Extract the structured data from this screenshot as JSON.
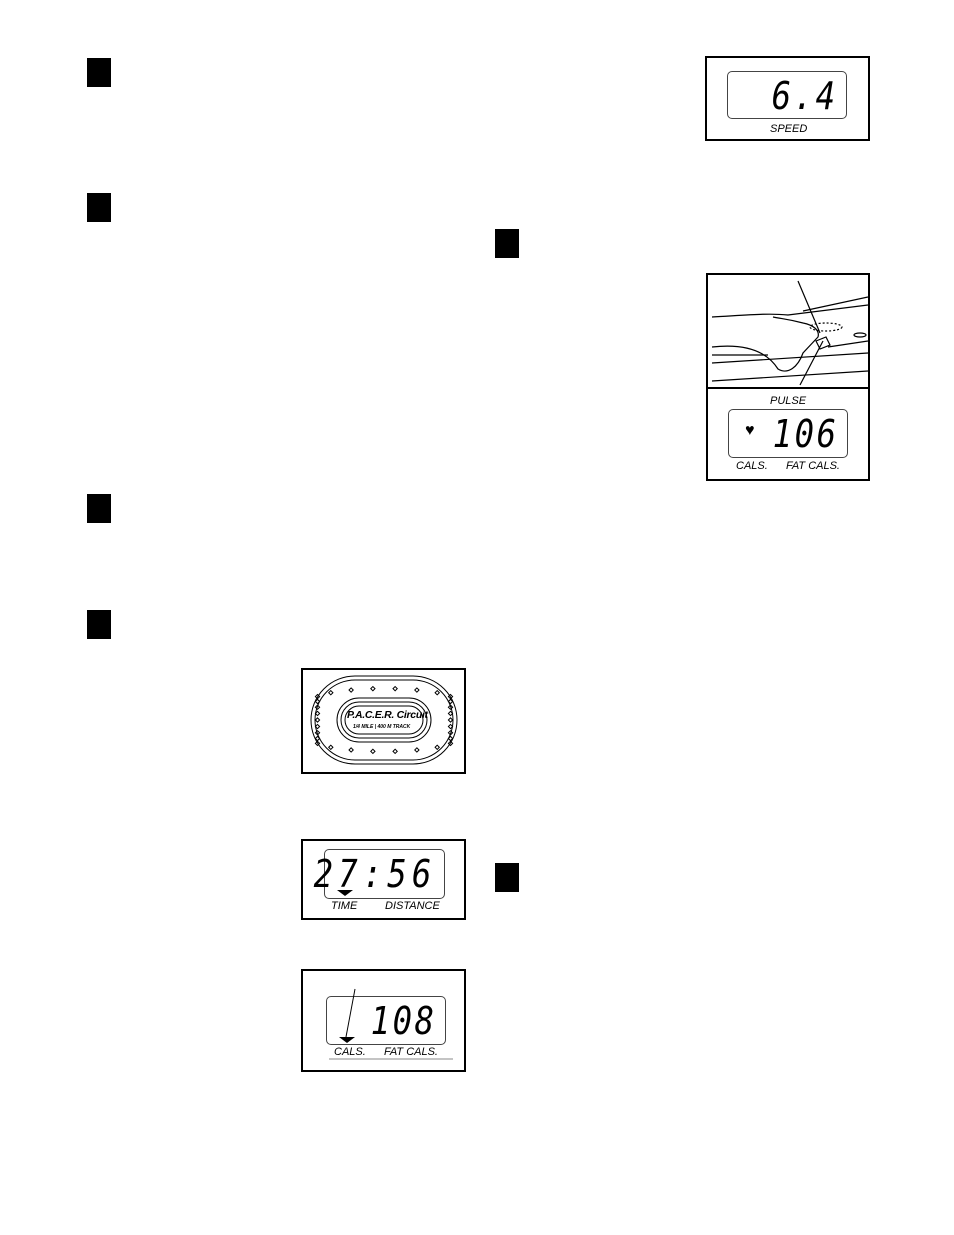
{
  "speed_display": {
    "value": "6.4",
    "label": "SPEED"
  },
  "pulse_display": {
    "title": "PULSE",
    "value": "106",
    "icon": "heart-icon",
    "labels": [
      "CALS.",
      "FAT CALS."
    ]
  },
  "pacer_track": {
    "logo": "P.A.C.E.R. Circuit",
    "subtitle": "1/4 MILE | 400 M TRACK"
  },
  "time_display": {
    "value": "27:56",
    "labels": [
      "TIME",
      "DISTANCE"
    ]
  },
  "cals_display": {
    "value": "108",
    "labels": [
      "CALS.",
      "FAT CALS."
    ]
  }
}
